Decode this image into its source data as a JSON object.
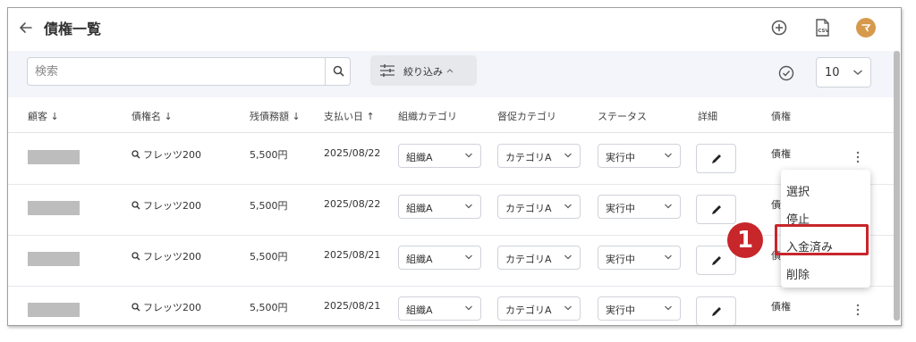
{
  "header": {
    "title": "債権一覧"
  },
  "toolbar": {
    "search_placeholder": "検索",
    "filter_label": "絞り込み",
    "page_size": "10"
  },
  "table": {
    "columns": [
      "顧客 ↓",
      "債権名 ↓",
      "残債務額 ↓",
      "支払い日 ↑",
      "組織カテゴリ",
      "督促カテゴリ",
      "ステータス",
      "詳細",
      "債権"
    ],
    "rows": [
      {
        "claim": "フレッツ200",
        "amount": "5,500円",
        "date": "2025/08/22",
        "org": "組織A",
        "dun": "カテゴリA",
        "status": "実行中",
        "type": "債権"
      },
      {
        "claim": "フレッツ200",
        "amount": "5,500円",
        "date": "2025/08/22",
        "org": "組織A",
        "dun": "カテゴリA",
        "status": "実行中",
        "type": "債"
      },
      {
        "claim": "フレッツ200",
        "amount": "5,500円",
        "date": "2025/08/21",
        "org": "組織A",
        "dun": "カテゴリA",
        "status": "実行中",
        "type": "債"
      },
      {
        "claim": "フレッツ200",
        "amount": "5,500円",
        "date": "2025/08/21",
        "org": "組織A",
        "dun": "カテゴリA",
        "status": "実行中",
        "type": "債権"
      }
    ]
  },
  "menu": {
    "items": [
      "選択",
      "停止",
      "入金済み",
      "削除"
    ]
  },
  "annotation": {
    "badge": "1"
  },
  "colors": {
    "highlight": "#c7262b",
    "avatar": "#d69a4c",
    "toolbar_bg": "#f3f5fa"
  }
}
